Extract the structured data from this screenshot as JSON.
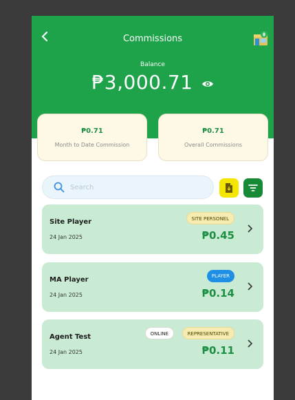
{
  "header": {
    "title": "Commissions",
    "balance_label": "Balance",
    "balance_value": "₱3,000.71",
    "back_icon": "chevron-left-icon",
    "shop_icon": "shop-icon",
    "eye_icon": "eye-icon"
  },
  "cards": [
    {
      "value": "₱0.71",
      "label": "Month to Date Commission"
    },
    {
      "value": "₱0.71",
      "label": "Overall Commissions"
    }
  ],
  "search": {
    "placeholder": "Search"
  },
  "actions": {
    "export_icon": "document-export-icon",
    "filter_icon": "filter-icon"
  },
  "list": [
    {
      "name": "Site Player",
      "date": "24 Jan 2025",
      "badges": [
        "SITE PERSONEL"
      ],
      "amount": "₱0.45"
    },
    {
      "name": "MA Player",
      "date": "24 Jan 2025",
      "badges": [
        "PLAYER"
      ],
      "amount": "₱0.14"
    },
    {
      "name": "Agent Test",
      "date": "24 Jan 2025",
      "badges": [
        "ONLINE",
        "REPRESENTATIVE"
      ],
      "amount": "₱0.11"
    }
  ],
  "colors": {
    "primary_green": "#1fa34a",
    "card_bg": "#fdf9e6",
    "list_item_bg": "#c9ebd3",
    "amount_green": "#1c8f44",
    "badge_yellow": "#f6ebb0",
    "badge_blue": "#1e8fe4",
    "export_yellow": "#f5e600",
    "filter_green": "#178a36"
  }
}
